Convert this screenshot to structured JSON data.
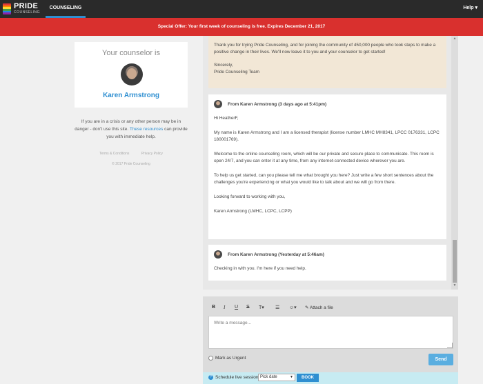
{
  "nav": {
    "logo_main": "PRIDE",
    "logo_sub": "COUNSELING",
    "tab_counseling": "COUNSELING",
    "help": "Help ▾",
    "flag_colors": [
      "#e53935",
      "#fb8c00",
      "#fdd835",
      "#43a047",
      "#1e88e5",
      "#8e24aa"
    ]
  },
  "offer": {
    "label": "Special Offer:",
    "text": "Your first week of counseling is free. Expires December 21, 2017"
  },
  "counselor": {
    "heading": "Your counselor is",
    "name": "Karen Armstrong"
  },
  "crisis": {
    "text_before": "If you are in a crisis or any other person may be in danger - don't use this site.",
    "link": "These resources",
    "text_after": "can provide you with immediate help."
  },
  "footer": {
    "terms": "Terms & Conditions",
    "privacy": "Privacy Policy",
    "copyright": "© 2017 Pride Counseling"
  },
  "welcome": {
    "body": "Thank you for trying Pride Counseling, and for joining the community of 450,000 people who took steps to make a positive change in their lives. We'll now leave it to you and your counselor to get started!",
    "signoff": "Sincerely,",
    "team": "Pride Counseling Team"
  },
  "messages": [
    {
      "from": "From Karen Armstrong (3 days ago at 5:41pm)",
      "paragraphs": [
        "Hi HeatherF,",
        "My name is Karen Armstrong and I am a licensed therapist (license number LMHC MH8341, LPCC 0176331, LCPC 180001769).",
        "Welcome to the online counseling room, which will be our private and secure place to communicate. This room is open 24/7, and you can enter it at any time, from any internet-connected device wherever you are.",
        "To help us get started, can you please tell me what brought you here? Just write a few short sentences about the challenges you're experiencing or what you would like to talk about and we will go from there.",
        "Looking forward to working with you,",
        "Karen Armstrong (LMHC, LCPC, LCPP)"
      ]
    },
    {
      "from": "From Karen Armstrong (Yesterday at 5:46am)",
      "paragraphs": [
        "Checking in with you. I'm here if you need help."
      ]
    }
  ],
  "composer": {
    "bold": "B",
    "italic": "I",
    "underline": "U",
    "strike": "S",
    "text_size": "T▾",
    "list": "☰",
    "emoji": "☺▾",
    "attach": "✎ Attach a file",
    "placeholder": "Write a message...",
    "urgent": "Mark as Urgent",
    "send": "Send"
  },
  "schedule": {
    "icon": "?",
    "label": "Schedule live session",
    "select_value": "Pick date",
    "book": "BOOK"
  },
  "colors": {
    "accent": "#2f8fd1",
    "banner": "#d9302e",
    "welcome_bg": "#f2e7d6"
  }
}
